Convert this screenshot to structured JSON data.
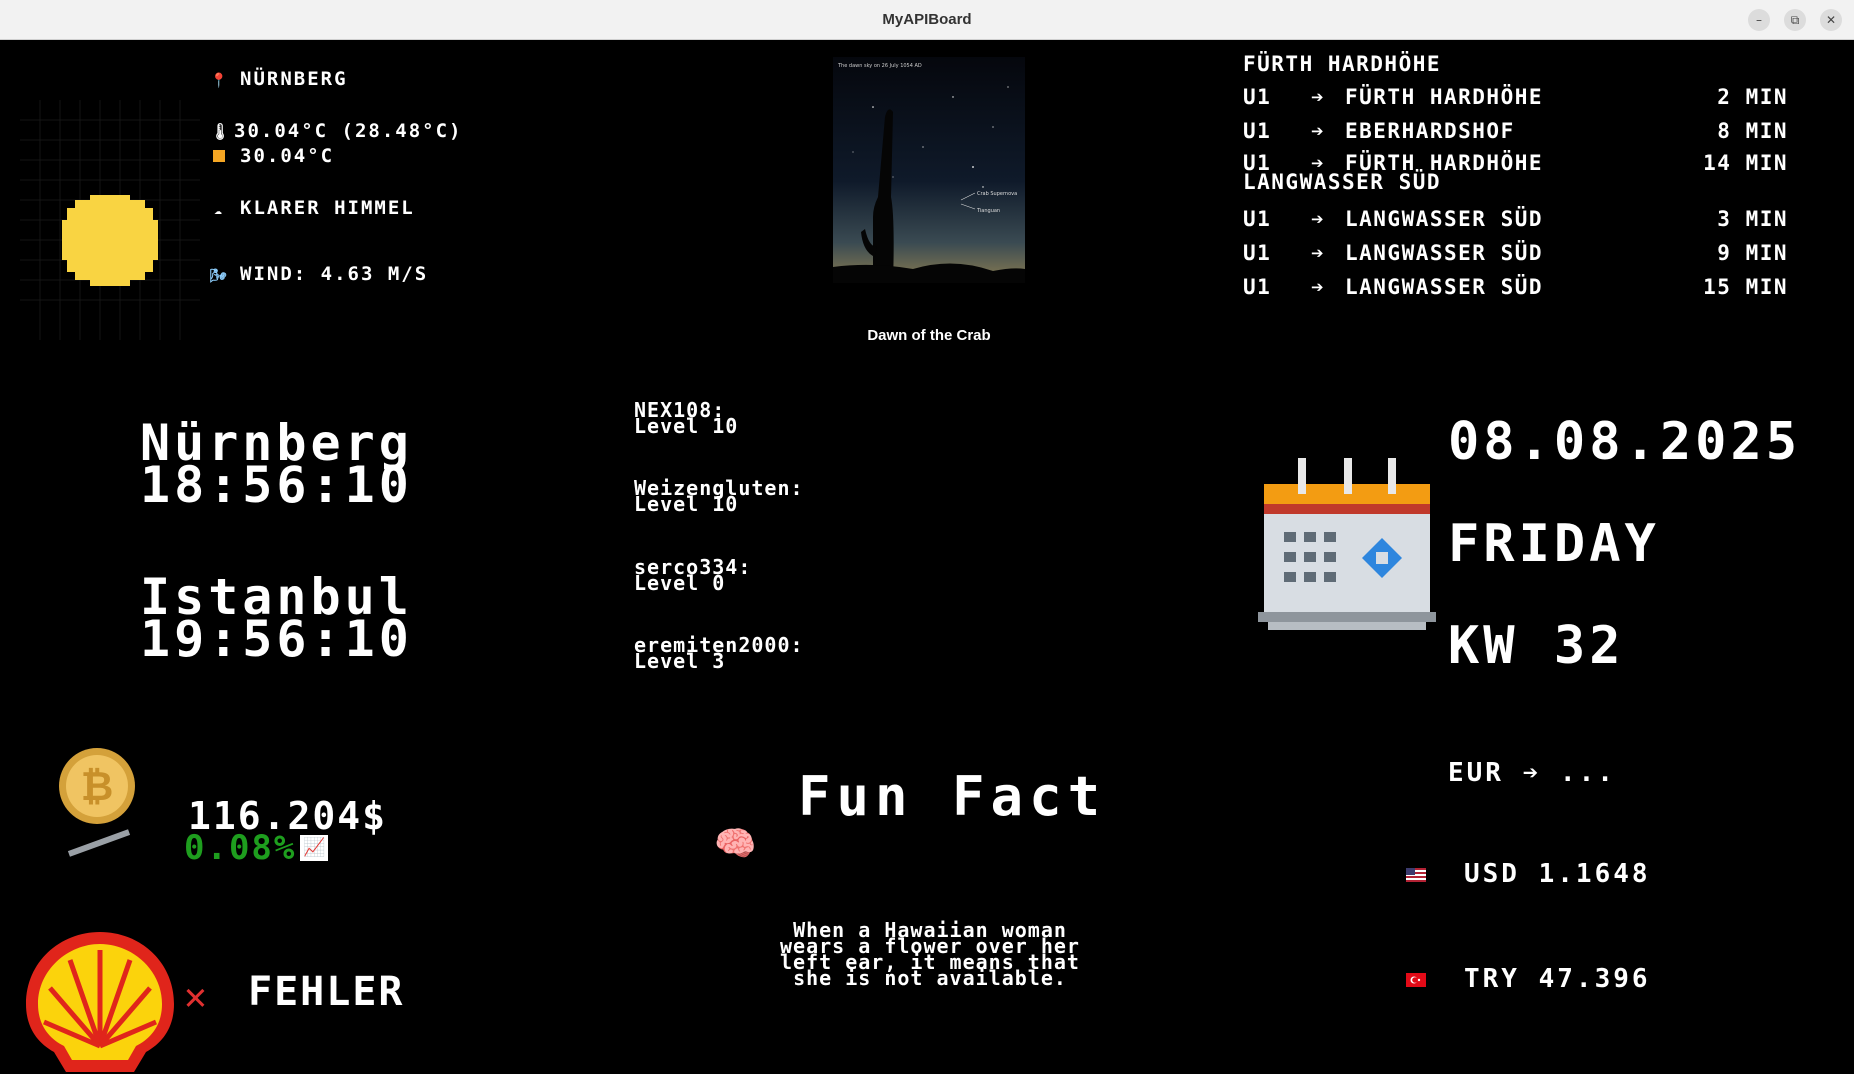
{
  "window": {
    "title": "MyAPIBoard",
    "buttons": {
      "minimize": "–",
      "restore": "⧉",
      "close": "✕"
    }
  },
  "weather": {
    "location": "NÜRNBERG",
    "temperature": "30.04°C (28.48°C)",
    "max_temperature": "30.04°C",
    "condition": "KLARER HIMMEL",
    "wind": "WIND: 4.63 M/S",
    "icon": "sun-icon"
  },
  "apod": {
    "image_caption_small": "The dawn sky on 26 July 1054 AD",
    "label_supernova": "Crab Supernova",
    "label_tianguan": "Tianguan",
    "title": "Dawn of the Crab"
  },
  "transit": {
    "station": "FÜRTH HARDHÖHE",
    "departures": [
      {
        "line": "U1",
        "arrow": "➔",
        "destination": "FÜRTH HARDHÖHE",
        "minutes": "2 MIN"
      },
      {
        "line": "U1",
        "arrow": "➔",
        "destination": "EBERHARDSHOF",
        "minutes": "8 MIN"
      },
      {
        "line": "U1",
        "arrow": "➔",
        "destination": "FÜRTH HARDHÖHE",
        "minutes": "14 MIN"
      }
    ],
    "station2": "LANGWASSER SÜD",
    "departures2": [
      {
        "line": "U1",
        "arrow": "➔",
        "destination": "LANGWASSER SÜD",
        "minutes": "3 MIN"
      },
      {
        "line": "U1",
        "arrow": "➔",
        "destination": "LANGWASSER SÜD",
        "minutes": "9 MIN"
      },
      {
        "line": "U1",
        "arrow": "➔",
        "destination": "LANGWASSER SÜD",
        "minutes": "15 MIN"
      }
    ]
  },
  "clocks": [
    {
      "city": "Nürnberg",
      "time": "18:56:10"
    },
    {
      "city": "Istanbul",
      "time": "19:56:10"
    }
  ],
  "players": [
    {
      "name": "NEX108:",
      "level": "Level 10"
    },
    {
      "name": "Weizengluten:",
      "level": "Level 10"
    },
    {
      "name": "serco334:",
      "level": "Level 0"
    },
    {
      "name": "eremiten2000:",
      "level": "Level 3"
    }
  ],
  "calendar": {
    "date": "08.08.2025",
    "weekday": "FRIDAY",
    "week": "KW 32",
    "icon": "calendar-icon"
  },
  "crypto": {
    "price": "116.204$",
    "change": "0.08%",
    "change_color": "#1e9e1e",
    "icon": "bitcoin-icon"
  },
  "fuel": {
    "status": "FEHLER",
    "error_icon": "✕",
    "error_color": "#e03030",
    "icon": "shell-logo"
  },
  "funfact": {
    "title": "Fun Fact",
    "text_lines": [
      "When a Hawaiian woman",
      "wears a flower over her",
      "left ear, it means that",
      "she is not available."
    ],
    "icon": "brain-icon"
  },
  "currency": {
    "header": "EUR ➔ ...",
    "rates": [
      {
        "code": "USD",
        "value": "1.1648",
        "flag": "us-flag-icon"
      },
      {
        "code": "TRY",
        "value": "47.396",
        "flag": "tr-flag-icon"
      }
    ]
  }
}
